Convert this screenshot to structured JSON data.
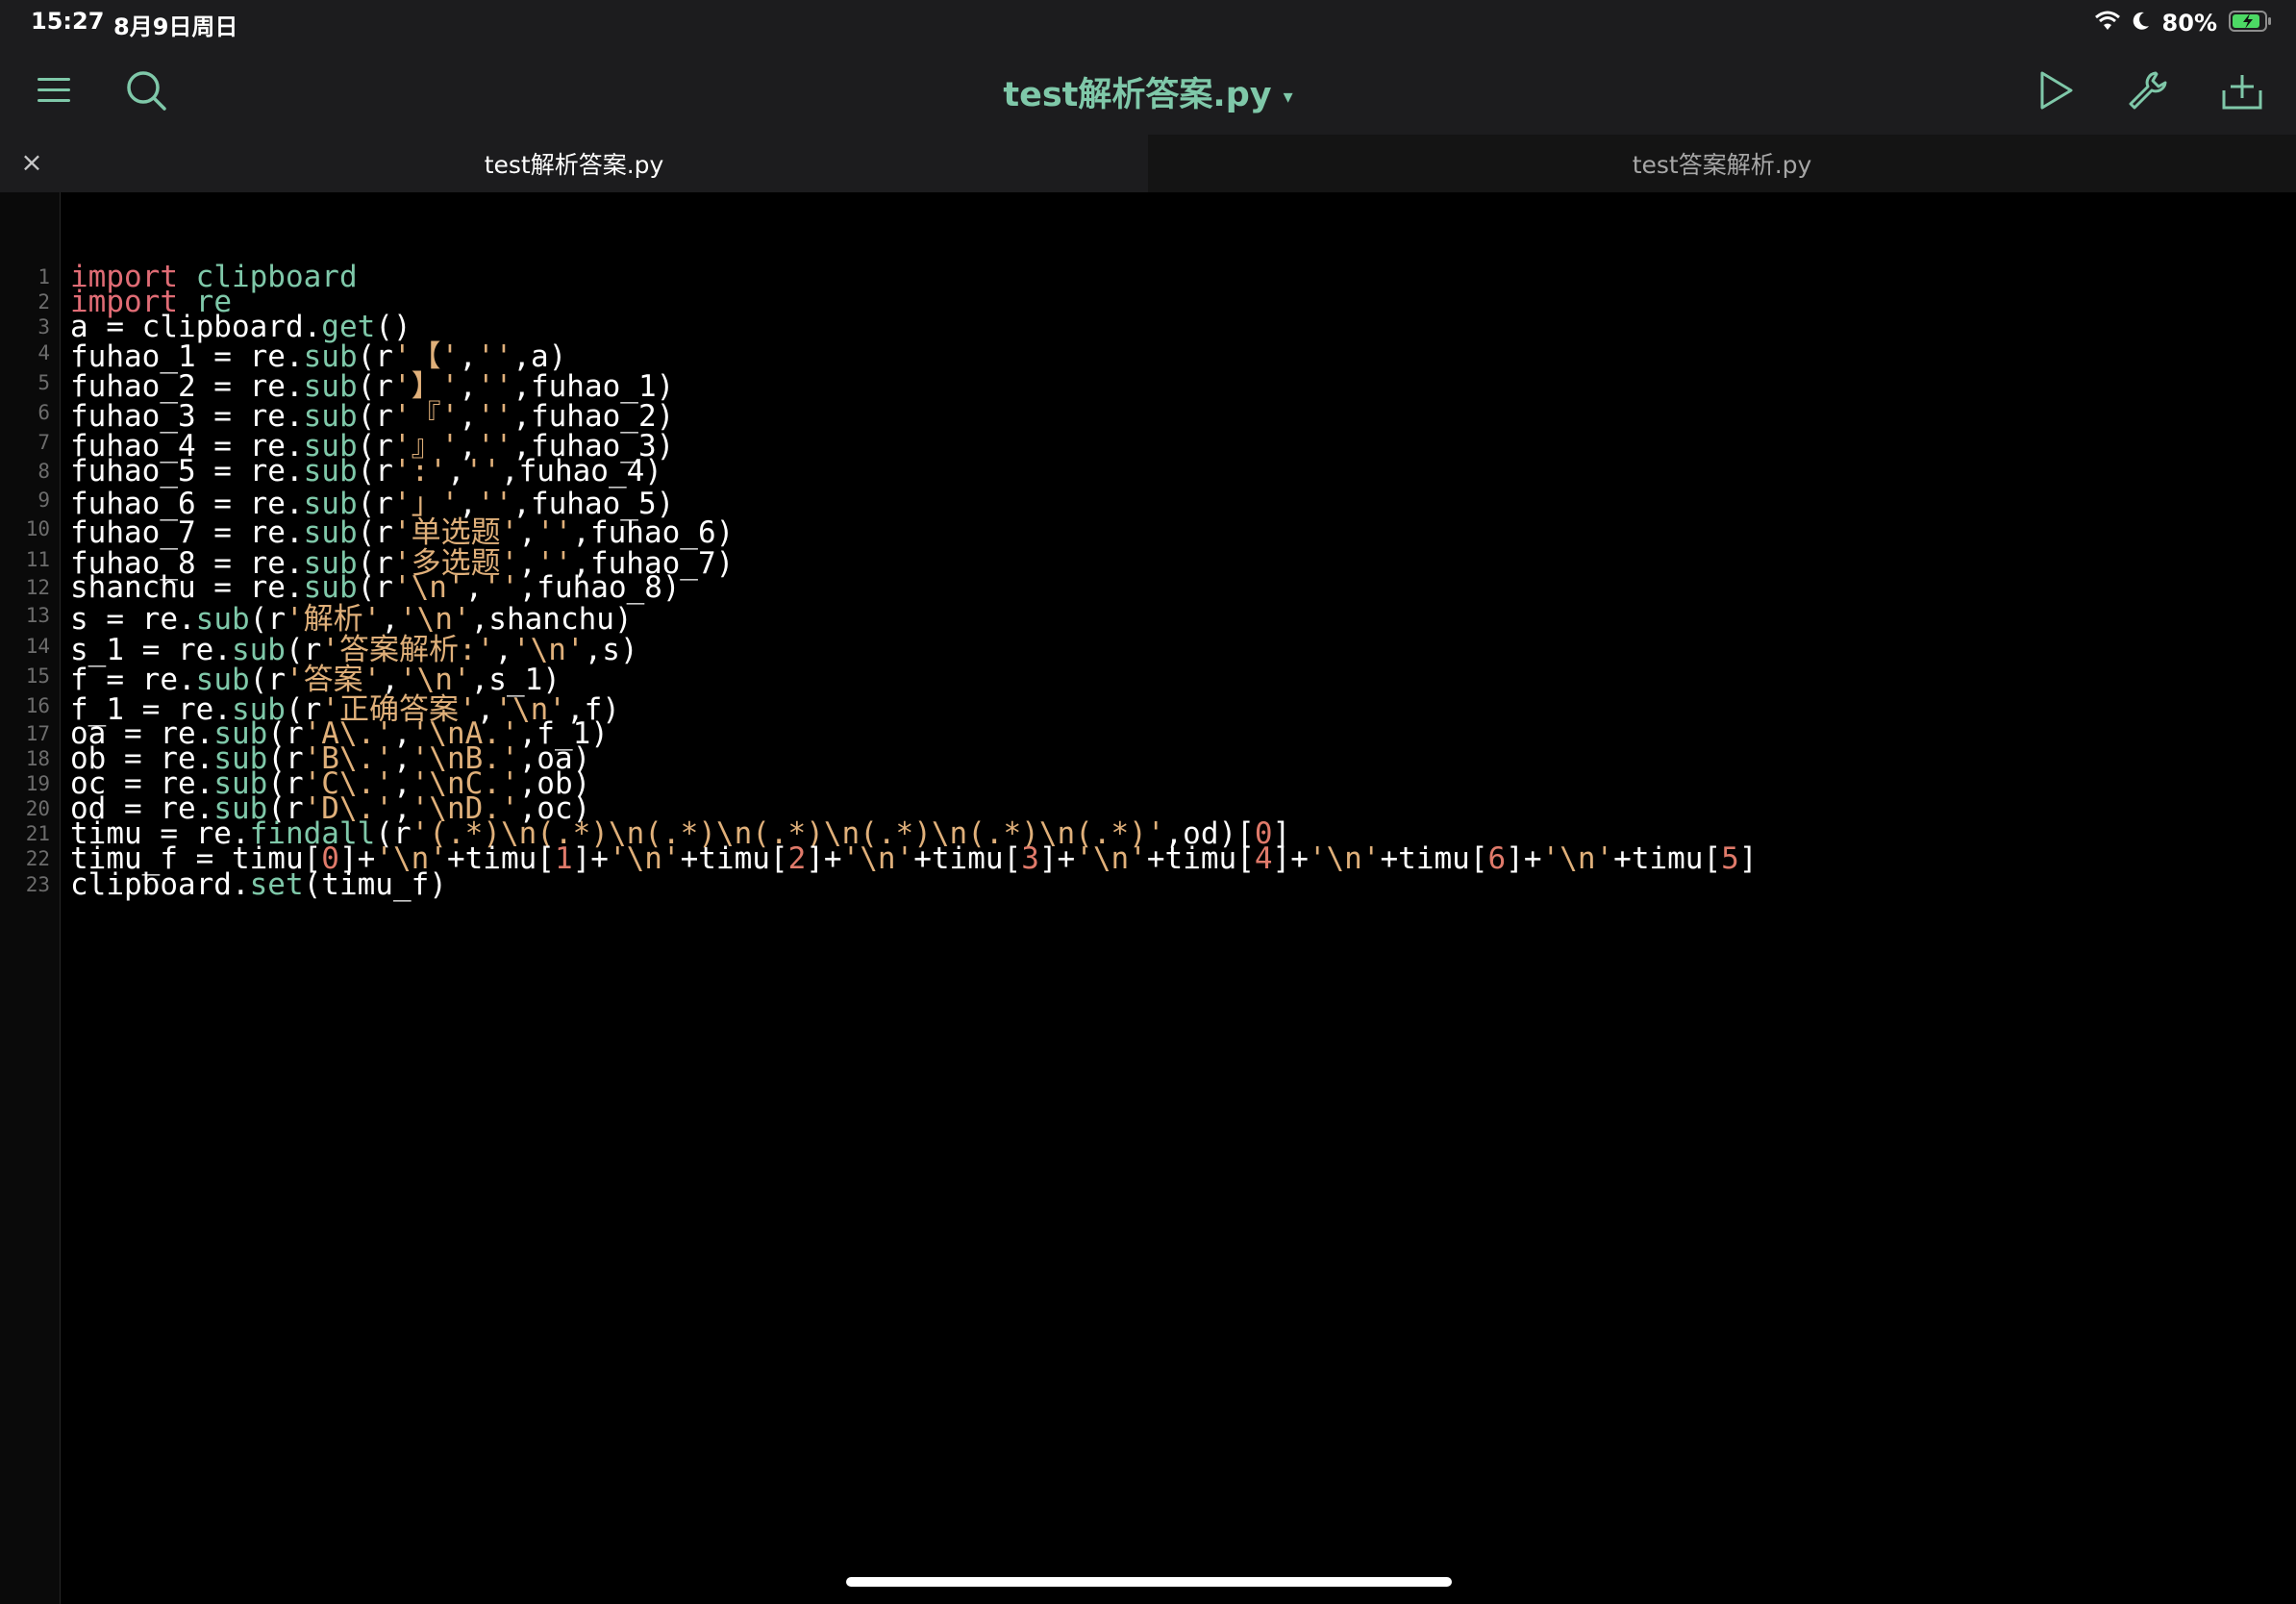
{
  "status": {
    "time": "15:27",
    "date": "8月9日周日",
    "battery": "80%"
  },
  "toolbar": {
    "title": "test解析答案.py",
    "title_caret": "▾"
  },
  "tabs": [
    {
      "label": "test解析答案.py",
      "active": true
    },
    {
      "label": "test答案解析.py",
      "active": false
    }
  ],
  "tab_close": "×",
  "lines": [
    [
      [
        "kw",
        "import"
      ],
      [
        "p",
        " "
      ],
      [
        "fn",
        "clipboard"
      ]
    ],
    [
      [
        "kw",
        "import"
      ],
      [
        "p",
        " "
      ],
      [
        "fn",
        "re"
      ]
    ],
    [
      [
        "p",
        "a = clipboard."
      ],
      [
        "fn",
        "get"
      ],
      [
        "p",
        "()"
      ]
    ],
    [
      [
        "p",
        "fuhao_1 = re."
      ],
      [
        "fn",
        "sub"
      ],
      [
        "p",
        "(r"
      ],
      [
        "str",
        "'【'"
      ],
      [
        "p",
        ","
      ],
      [
        "str",
        "''"
      ],
      [
        "p",
        ",a)"
      ]
    ],
    [
      [
        "p",
        "fuhao_2 = re."
      ],
      [
        "fn",
        "sub"
      ],
      [
        "p",
        "(r"
      ],
      [
        "str",
        "'】'"
      ],
      [
        "p",
        ","
      ],
      [
        "str",
        "''"
      ],
      [
        "p",
        ",fuhao_1)"
      ]
    ],
    [
      [
        "p",
        "fuhao_3 = re."
      ],
      [
        "fn",
        "sub"
      ],
      [
        "p",
        "(r"
      ],
      [
        "str",
        "'『'"
      ],
      [
        "p",
        ","
      ],
      [
        "str",
        "''"
      ],
      [
        "p",
        ",fuhao_2)"
      ]
    ],
    [
      [
        "p",
        "fuhao_4 = re."
      ],
      [
        "fn",
        "sub"
      ],
      [
        "p",
        "(r"
      ],
      [
        "str",
        "'』'"
      ],
      [
        "p",
        ","
      ],
      [
        "str",
        "''"
      ],
      [
        "p",
        ",fuhao_3)"
      ]
    ],
    [
      [
        "p",
        "fuhao_5 = re."
      ],
      [
        "fn",
        "sub"
      ],
      [
        "p",
        "(r"
      ],
      [
        "str",
        "':'"
      ],
      [
        "p",
        ","
      ],
      [
        "str",
        "''"
      ],
      [
        "p",
        ",fuhao_4)"
      ]
    ],
    [
      [
        "p",
        "fuhao_6 = re."
      ],
      [
        "fn",
        "sub"
      ],
      [
        "p",
        "(r"
      ],
      [
        "str",
        "'」'"
      ],
      [
        "p",
        ","
      ],
      [
        "str",
        "''"
      ],
      [
        "p",
        ",fuhao_5)"
      ]
    ],
    [
      [
        "p",
        "fuhao_7 = re."
      ],
      [
        "fn",
        "sub"
      ],
      [
        "p",
        "(r"
      ],
      [
        "str",
        "'单选题'"
      ],
      [
        "p",
        ","
      ],
      [
        "str",
        "''"
      ],
      [
        "p",
        ",fuhao_6)"
      ]
    ],
    [
      [
        "p",
        "fuhao_8 = re."
      ],
      [
        "fn",
        "sub"
      ],
      [
        "p",
        "(r"
      ],
      [
        "str",
        "'多选题'"
      ],
      [
        "p",
        ","
      ],
      [
        "str",
        "''"
      ],
      [
        "p",
        ",fuhao_7)"
      ]
    ],
    [
      [
        "p",
        "shanchu = re."
      ],
      [
        "fn",
        "sub"
      ],
      [
        "p",
        "(r"
      ],
      [
        "str",
        "'\\n'"
      ],
      [
        "p",
        ","
      ],
      [
        "str",
        "''"
      ],
      [
        "p",
        ",fuhao_8)"
      ]
    ],
    [
      [
        "p",
        "s = re."
      ],
      [
        "fn",
        "sub"
      ],
      [
        "p",
        "(r"
      ],
      [
        "str",
        "'解析'"
      ],
      [
        "p",
        ","
      ],
      [
        "str",
        "'\\n'"
      ],
      [
        "p",
        ",shanchu)"
      ]
    ],
    [
      [
        "p",
        "s_1 = re."
      ],
      [
        "fn",
        "sub"
      ],
      [
        "p",
        "(r"
      ],
      [
        "str",
        "'答案解析:'"
      ],
      [
        "p",
        ","
      ],
      [
        "str",
        "'\\n'"
      ],
      [
        "p",
        ",s)"
      ]
    ],
    [
      [
        "p",
        "f = re."
      ],
      [
        "fn",
        "sub"
      ],
      [
        "p",
        "(r"
      ],
      [
        "str",
        "'答案'"
      ],
      [
        "p",
        ","
      ],
      [
        "str",
        "'\\n'"
      ],
      [
        "p",
        ",s_1)"
      ]
    ],
    [
      [
        "p",
        "f_1 = re."
      ],
      [
        "fn",
        "sub"
      ],
      [
        "p",
        "(r"
      ],
      [
        "str",
        "'正确答案'"
      ],
      [
        "p",
        ","
      ],
      [
        "str",
        "'\\n'"
      ],
      [
        "p",
        ",f)"
      ]
    ],
    [
      [
        "p",
        "oa = re."
      ],
      [
        "fn",
        "sub"
      ],
      [
        "p",
        "(r"
      ],
      [
        "str",
        "'A\\.'"
      ],
      [
        "p",
        ","
      ],
      [
        "str",
        "'\\nA.'"
      ],
      [
        "p",
        ",f_1)"
      ]
    ],
    [
      [
        "p",
        "ob = re."
      ],
      [
        "fn",
        "sub"
      ],
      [
        "p",
        "(r"
      ],
      [
        "str",
        "'B\\.'"
      ],
      [
        "p",
        ","
      ],
      [
        "str",
        "'\\nB.'"
      ],
      [
        "p",
        ",oa)"
      ]
    ],
    [
      [
        "p",
        "oc = re."
      ],
      [
        "fn",
        "sub"
      ],
      [
        "p",
        "(r"
      ],
      [
        "str",
        "'C\\.'"
      ],
      [
        "p",
        ","
      ],
      [
        "str",
        "'\\nC.'"
      ],
      [
        "p",
        ",ob)"
      ]
    ],
    [
      [
        "p",
        "od = re."
      ],
      [
        "fn",
        "sub"
      ],
      [
        "p",
        "(r"
      ],
      [
        "str",
        "'D\\.'"
      ],
      [
        "p",
        ","
      ],
      [
        "str",
        "'\\nD.'"
      ],
      [
        "p",
        ",oc)"
      ]
    ],
    [
      [
        "p",
        "timu = re."
      ],
      [
        "fn",
        "findall"
      ],
      [
        "p",
        "(r"
      ],
      [
        "str",
        "'(.*)\\n(.*)\\n(.*)\\n(.*)\\n(.*)\\n(.*)\\n(.*)'"
      ],
      [
        "p",
        ",od)["
      ],
      [
        "num",
        "0"
      ],
      [
        "p",
        "]"
      ]
    ],
    [
      [
        "p",
        "timu_f = timu["
      ],
      [
        "num",
        "0"
      ],
      [
        "p",
        "]+"
      ],
      [
        "str",
        "'\\n'"
      ],
      [
        "p",
        "+timu["
      ],
      [
        "num",
        "1"
      ],
      [
        "p",
        "]+"
      ],
      [
        "str",
        "'\\n'"
      ],
      [
        "p",
        "+timu["
      ],
      [
        "num",
        "2"
      ],
      [
        "p",
        "]+"
      ],
      [
        "str",
        "'\\n'"
      ],
      [
        "p",
        "+timu["
      ],
      [
        "num",
        "3"
      ],
      [
        "p",
        "]+"
      ],
      [
        "str",
        "'\\n'"
      ],
      [
        "p",
        "+timu["
      ],
      [
        "num",
        "4"
      ],
      [
        "p",
        "]+"
      ],
      [
        "str",
        "'\\n'"
      ],
      [
        "p",
        "+timu["
      ],
      [
        "num",
        "6"
      ],
      [
        "p",
        "]+"
      ],
      [
        "str",
        "'\\n'"
      ],
      [
        "p",
        "+timu["
      ],
      [
        "num",
        "5"
      ],
      [
        "p",
        "]"
      ]
    ],
    [
      [
        "p",
        "clipboard."
      ],
      [
        "fn",
        "set"
      ],
      [
        "p",
        "(timu_f)"
      ]
    ]
  ]
}
